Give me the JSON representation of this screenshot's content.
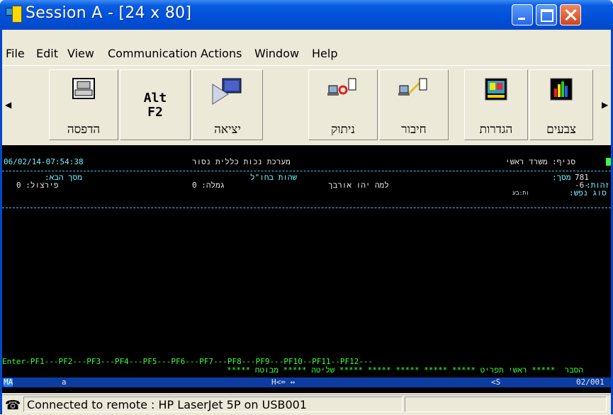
{
  "window": {
    "title": "Session A - [24 x 80]"
  },
  "menu": [
    "File",
    "Edit",
    "View",
    "Communication",
    "Actions",
    "Window",
    "Help"
  ],
  "toolbar": {
    "buttons": [
      {
        "label": "הדפסה",
        "icon": "printer-icon"
      },
      {
        "label": "Alt F2",
        "icon": "alt-f2-key"
      },
      {
        "label": "יציאה",
        "icon": "exit-icon"
      },
      {
        "label": "ניתוק",
        "icon": "disconnect-icon"
      },
      {
        "label": "חיבור",
        "icon": "connect-icon"
      },
      {
        "label": "הגדרות",
        "icon": "settings-icon"
      },
      {
        "label": "צבעים",
        "icon": "colors-icon"
      }
    ],
    "alt_top": "Alt",
    "alt_bottom": "F2"
  },
  "terminal": {
    "datetime": "06/02/14-07:54:38",
    "system": "מערכת נכות כללית נסור",
    "branch": "סניף: משרד ראשי",
    "next_screen": "מסך הבא:",
    "stay_abroad": "שהות בחו\"ל",
    "screen_label": "מסך:",
    "screen_num": "781",
    "id_label": "זהות:",
    "id_val": "-6-",
    "persontype_label": "סוג נפש:",
    "why_line": "למה יהו אורבך",
    "gimla": "גמלה: 0",
    "pirzul": "פירצול: 0",
    "small_mark": "ות:בע",
    "pf_line": "Enter-PF1---PF2---PF3---PF4---PF5---PF6---PF7---PF8---PF9---PF10--PF11--PF12---",
    "pf_labels": "הסבר  ***** ראשי תפריט ***** ***** ***** ***** ***** שליטה ***** מבוטח *****",
    "oia_left": "MA",
    "oia_a": "a",
    "oia_mid": "H<= ↔",
    "oia_s": "<S",
    "oia_right": "02/001"
  },
  "status": {
    "text": "Connected to remote : HP LaserJet 5P on USB001"
  }
}
